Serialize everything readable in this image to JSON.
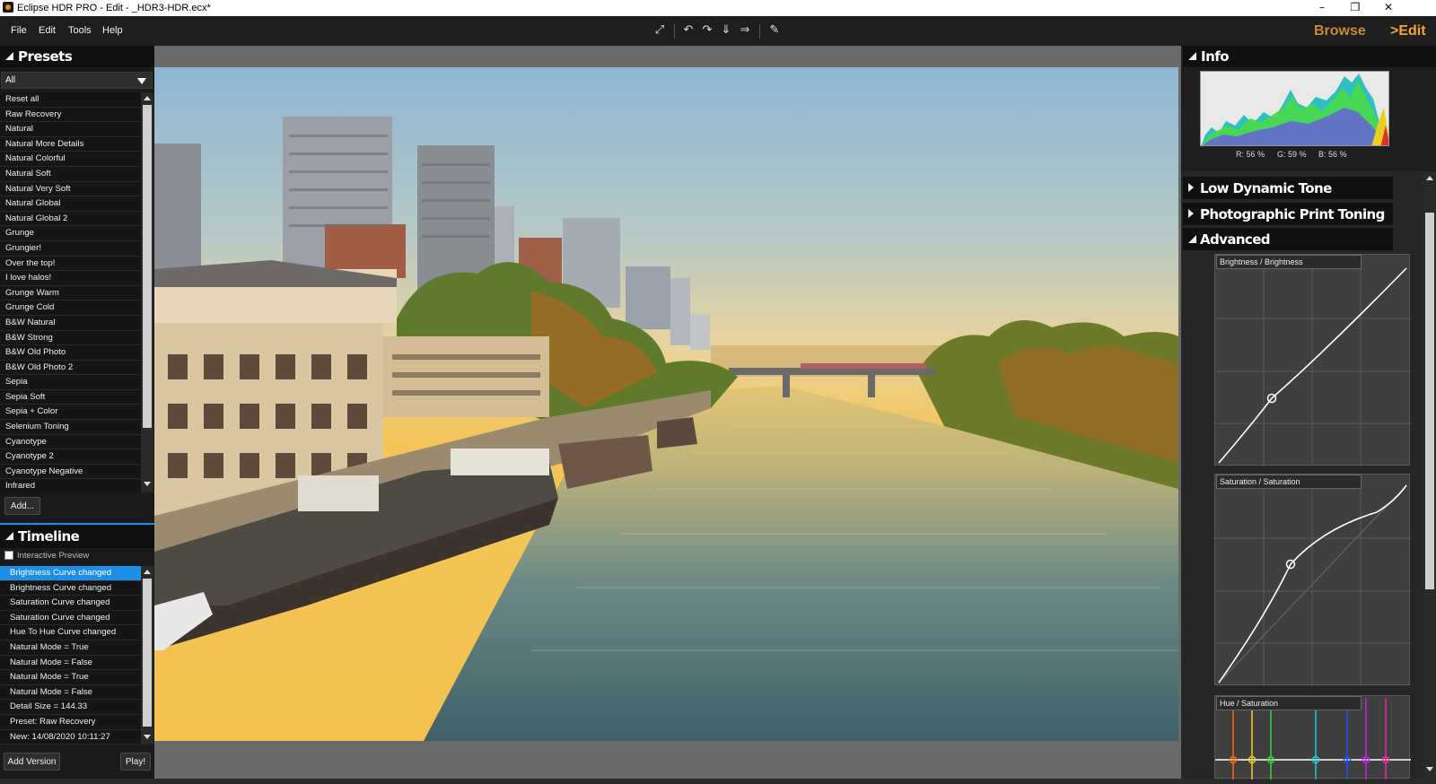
{
  "window": {
    "title": "Eclipse HDR PRO - Edit - _HDR3-HDR.ecx*",
    "controls": [
      "–",
      "❐",
      "✕"
    ]
  },
  "menu": [
    "File",
    "Edit",
    "Tools",
    "Help"
  ],
  "toolbar": {
    "icons": [
      "fit-screen-icon",
      "rotate-left-icon",
      "rotate-right-icon",
      "flip-vertical-icon",
      "flip-horizontal-icon",
      "brush-icon"
    ],
    "glyphs": [
      "⤢",
      "↶",
      "↷",
      "⇓",
      "⇒",
      "✎"
    ]
  },
  "modes": {
    "browse": "Browse",
    "edit": ">Edit"
  },
  "presets": {
    "title": "Presets",
    "filter": "All",
    "items": [
      "Reset all",
      "Raw Recovery",
      "Natural",
      "Natural More Details",
      "Natural Colorful",
      "Natural Soft",
      "Natural Very Soft",
      "Natural Global",
      "Natural Global 2",
      "Grunge",
      "Grungier!",
      "Over the top!",
      "I love halos!",
      "Grunge Warm",
      "Grunge Cold",
      "B&W Natural",
      "B&W Strong",
      "B&W Old Photo",
      "B&W Old Photo 2",
      "Sepia",
      "Sepia Soft",
      "Sepia + Color",
      "Selenium Toning",
      "Cyanotype",
      "Cyanotype 2",
      "Cyanotype Negative",
      "Infrared"
    ],
    "add_label": "Add..."
  },
  "timeline": {
    "title": "Timeline",
    "interactive_preview": "Interactive Preview",
    "items": [
      "Brightness Curve changed",
      "Brightness Curve changed",
      "Saturation Curve changed",
      "Saturation Curve changed",
      "Hue To Hue Curve changed",
      "Natural Mode = True",
      "Natural Mode = False",
      "Natural Mode = True",
      "Natural Mode = False",
      "Detail Size = 144.33",
      "Preset: Raw Recovery",
      "New: 14/08/2020 10:11:27"
    ],
    "selected_index": 0,
    "add_version_label": "Add Version",
    "play_label": "Play!"
  },
  "info": {
    "title": "Info",
    "r": "R: 56 %",
    "g": "G: 59 %",
    "b": "B: 56 %"
  },
  "sections": {
    "low_dynamic": "Low Dynamic Tone",
    "print_toning": "Photographic Print Toning",
    "advanced": "Advanced"
  },
  "curves": {
    "brightness": "Brightness / Brightness",
    "saturation": "Saturation / Saturation",
    "hue": "Hue / Saturation",
    "hue_colors": [
      "#ff6a00",
      "#f0d020",
      "#3ad040",
      "#20c8d8",
      "#2050f0",
      "#c020f0",
      "#f020a0"
    ]
  },
  "colors": {
    "accent": "#1f8fe6",
    "mode_active": "#f0a640",
    "mode_inactive": "#c8883a"
  }
}
